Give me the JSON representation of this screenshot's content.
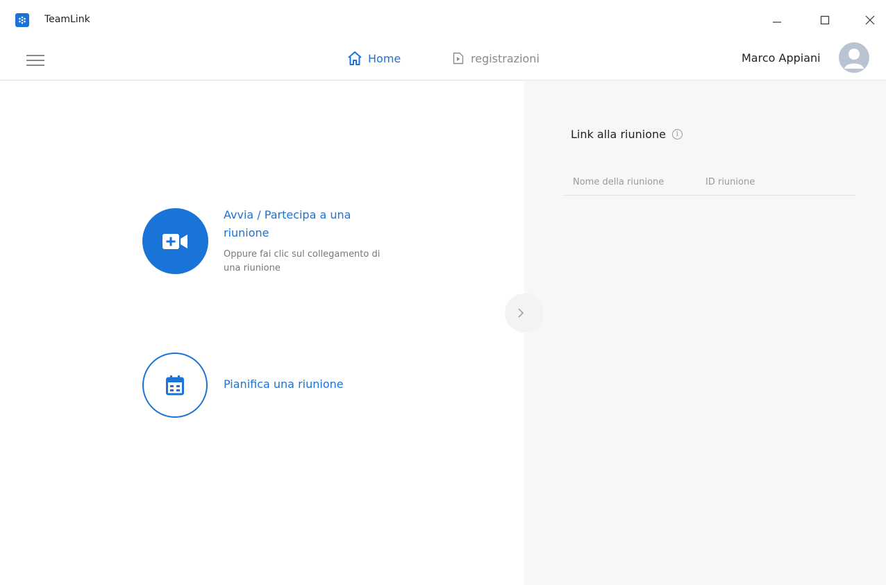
{
  "window": {
    "title": "TeamLink",
    "logo_icon": "teamlink-logo-icon",
    "controls": [
      "minimize-icon",
      "maximize-icon",
      "close-icon"
    ]
  },
  "nav": {
    "home_label": "Home",
    "recordings_label": "registrazioni",
    "active_tab": "Home",
    "user_name": "Marco Appiani"
  },
  "main": {
    "start_meeting": {
      "title": "Avvia / Partecipa a una riunione",
      "subtitle": "Oppure fai clic sul collegamento di una riunione"
    },
    "schedule_meeting": {
      "title": "Pianifica una riunione"
    }
  },
  "panel": {
    "title": "Link alla riunione",
    "columns": [
      "Nome della riunione",
      "ID riunione"
    ]
  },
  "colors": {
    "accent": "#1a73d6",
    "panel_bg": "#f7f7f7",
    "muted_text": "#999999"
  }
}
